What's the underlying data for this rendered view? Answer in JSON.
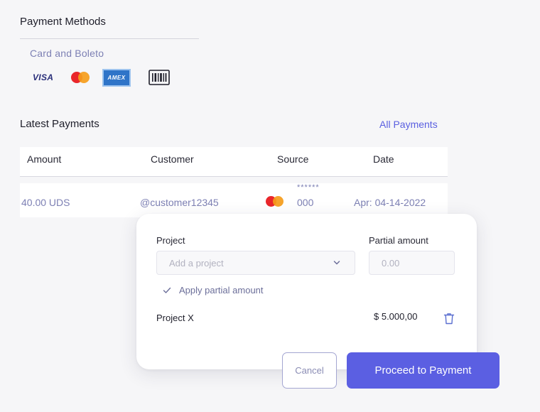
{
  "payment_methods": {
    "title": "Payment Methods",
    "subtitle": "Card and Boleto",
    "icons": [
      "visa-icon",
      "mastercard-icon",
      "amex-icon",
      "barcode-icon"
    ],
    "visa_text": "VISA",
    "amex_text": "AMEX"
  },
  "latest_payments": {
    "title": "Latest Payments",
    "all_link": "All Payments",
    "columns": [
      "Amount",
      "Customer",
      "Source",
      "Date"
    ],
    "rows": [
      {
        "amount": "40.00 UDS",
        "customer": "@customer12345",
        "source_masked": "******",
        "source_last": "000",
        "date": "Apr: 04-14-2022"
      }
    ]
  },
  "modal": {
    "project_label": "Project",
    "project_placeholder": "Add a project",
    "partial_label": "Partial amount",
    "partial_placeholder": "0.00",
    "apply_label": "Apply partial amount",
    "project_name": "Project X",
    "project_amount": "$ 5.000,00"
  },
  "actions": {
    "cancel": "Cancel",
    "proceed": "Proceed to Payment"
  },
  "colors": {
    "accent": "#5b5fe2",
    "link": "#5a5fe0",
    "muted_text": "#7d80b4",
    "background": "#f6f6f8"
  }
}
